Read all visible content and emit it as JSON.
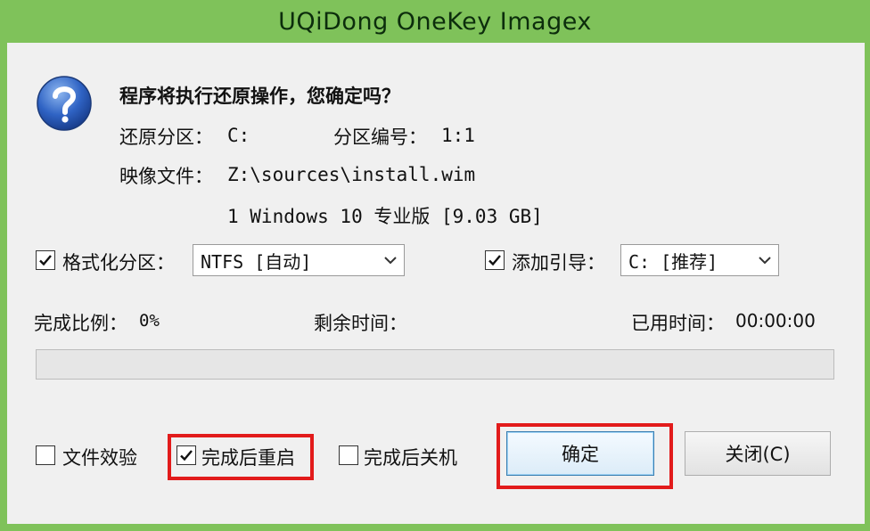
{
  "window": {
    "title": "UQiDong OneKey Imagex"
  },
  "icons": {
    "question": "question-mark-icon",
    "checkmark": "checkmark-icon",
    "dropdown": "chevron-down-icon"
  },
  "colors": {
    "titlebar": "#7fc25a",
    "highlight": "#e21b1b",
    "progress_fill": "#06b025"
  },
  "message": {
    "question": "程序将执行还原操作，您确定吗？"
  },
  "restore": {
    "partition_label": "还原分区：",
    "partition_value": "C:",
    "partition_number_label": "分区编号：",
    "partition_number_value": "1:1"
  },
  "image": {
    "label": "映像文件：",
    "path": "Z:\\sources\\install.wim",
    "edition": "1 Windows 10 专业版 [9.03 GB]"
  },
  "format": {
    "checked": true,
    "label": "格式化分区：",
    "selected": "NTFS [自动]"
  },
  "boot": {
    "checked": true,
    "label": "添加引导：",
    "selected": "C: [推荐]"
  },
  "progress": {
    "ratio_label": "完成比例：",
    "ratio_value": "0%",
    "remaining_label": "剩余时间：",
    "remaining_value": "",
    "elapsed_label": "已用时间：",
    "elapsed_value": "00:00:00",
    "fraction": 0
  },
  "options": {
    "verify": {
      "checked": false,
      "label": "文件效验"
    },
    "restart": {
      "checked": true,
      "label": "完成后重启"
    },
    "shutdown": {
      "checked": false,
      "label": "完成后关机"
    }
  },
  "buttons": {
    "ok": "确定",
    "close": "关闭(C)"
  }
}
